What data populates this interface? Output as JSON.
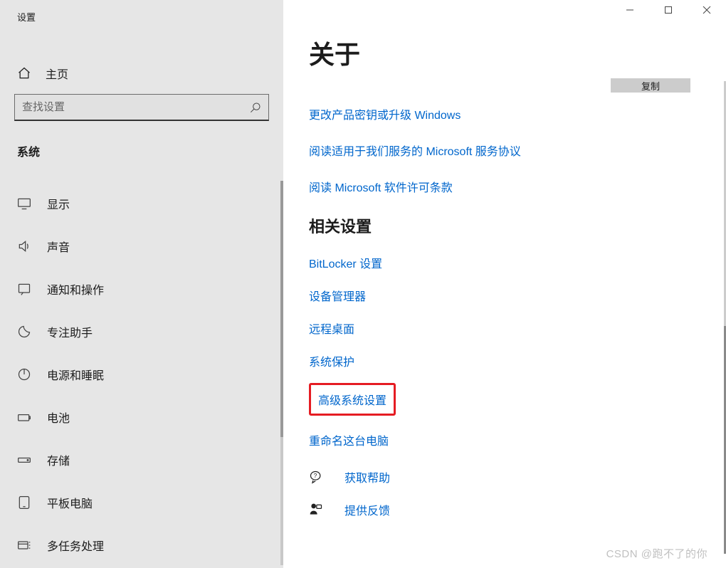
{
  "app": {
    "title": "设置"
  },
  "home": {
    "label": "主页"
  },
  "search": {
    "placeholder": "查找设置"
  },
  "section": {
    "heading": "系统"
  },
  "sidebar": {
    "items": [
      {
        "label": "显示"
      },
      {
        "label": "声音"
      },
      {
        "label": "通知和操作"
      },
      {
        "label": "专注助手"
      },
      {
        "label": "电源和睡眠"
      },
      {
        "label": "电池"
      },
      {
        "label": "存储"
      },
      {
        "label": "平板电脑"
      },
      {
        "label": "多任务处理"
      }
    ]
  },
  "main": {
    "title": "关于",
    "copy_label": "复制",
    "links": [
      "更改产品密钥或升级 Windows",
      "阅读适用于我们服务的 Microsoft 服务协议",
      "阅读 Microsoft 软件许可条款"
    ],
    "related_heading": "相关设置",
    "related": [
      "BitLocker 设置",
      "设备管理器",
      "远程桌面",
      "系统保护",
      "高级系统设置",
      "重命名这台电脑"
    ],
    "help": {
      "label": "获取帮助"
    },
    "feedback": {
      "label": "提供反馈"
    }
  },
  "watermark": "CSDN @跑不了的你"
}
